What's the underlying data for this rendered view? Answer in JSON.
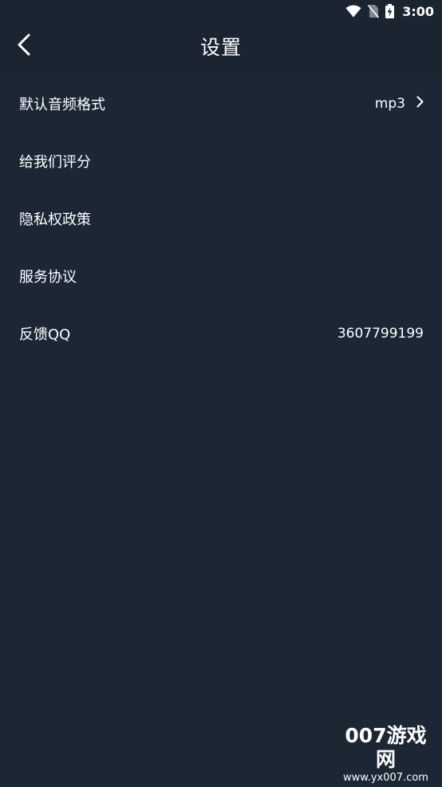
{
  "status_bar": {
    "time": "3:00",
    "icons": [
      "wifi-icon",
      "no-sim-icon",
      "battery-charging-icon"
    ]
  },
  "header": {
    "title": "设置",
    "back_icon": "chevron-left-icon"
  },
  "settings": [
    {
      "label": "默认音频格式",
      "value": "mp3",
      "has_chevron": true
    },
    {
      "label": "给我们评分"
    },
    {
      "label": "隐私权政策"
    },
    {
      "label": "服务协议"
    },
    {
      "label": "反馈QQ",
      "value": "3607799199"
    }
  ],
  "watermark": {
    "main": "007游戏网",
    "sub": "www.yx007.com"
  },
  "colors": {
    "background": "#1b2734",
    "app_bar": "#1a2531",
    "text": "#ffffff"
  }
}
